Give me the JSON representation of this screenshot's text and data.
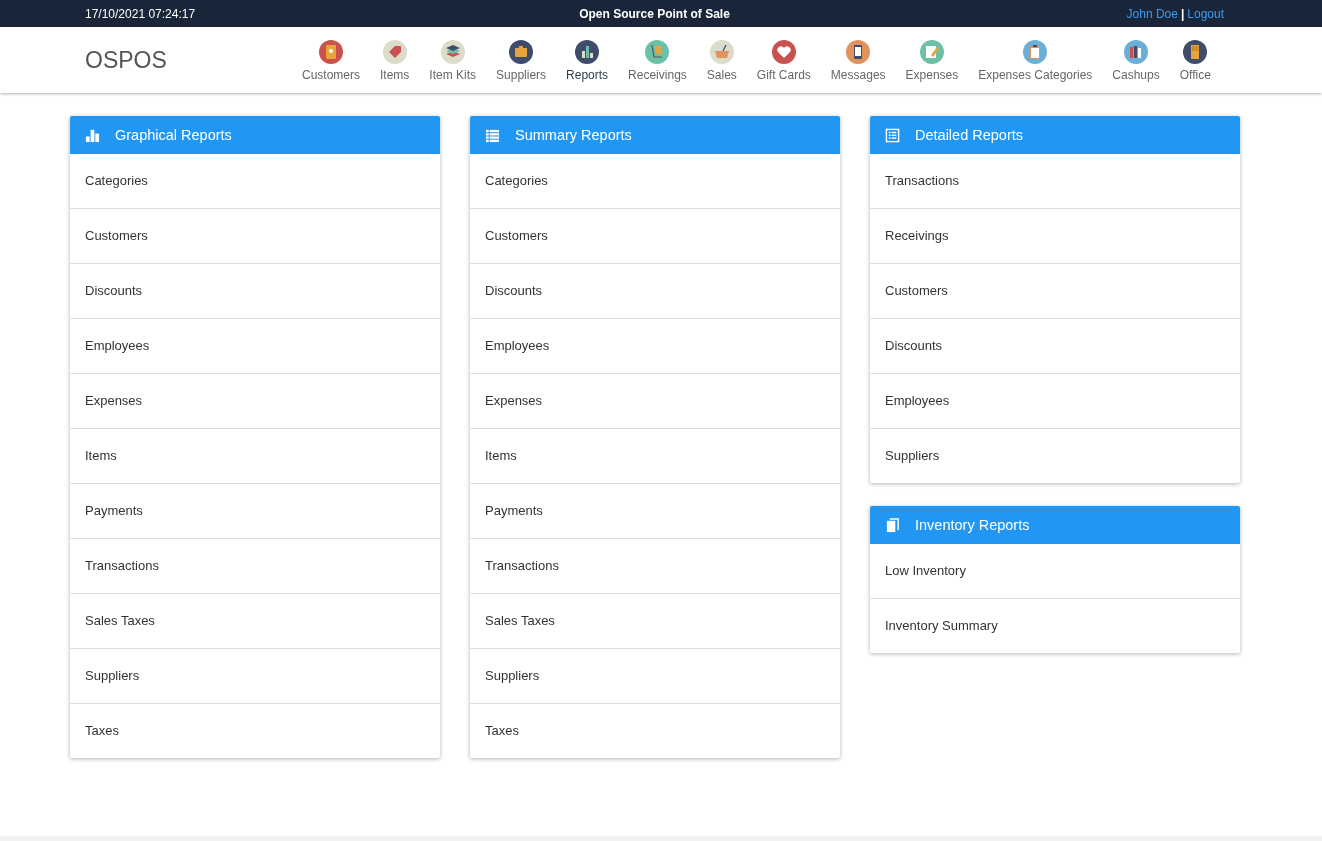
{
  "top_bar": {
    "datetime": "17/10/2021 07:24:17",
    "title": "Open Source Point of Sale",
    "user": "John Doe",
    "separator": "|",
    "logout": "Logout"
  },
  "brand": "OSPOS",
  "nav": [
    {
      "label": "Customers",
      "kind": "book",
      "color": "#c9524f",
      "selected": false
    },
    {
      "label": "Items",
      "kind": "tag",
      "color": "#dcdccb",
      "selected": false
    },
    {
      "label": "Item Kits",
      "kind": "stack",
      "color": "#dcdccb",
      "selected": false
    },
    {
      "label": "Suppliers",
      "kind": "briefcase",
      "color": "#3f4d6b",
      "selected": false
    },
    {
      "label": "Reports",
      "kind": "bars",
      "color": "#3f4d6b",
      "selected": true
    },
    {
      "label": "Receivings",
      "kind": "dolly",
      "color": "#6cc0a8",
      "selected": false
    },
    {
      "label": "Sales",
      "kind": "basket",
      "color": "#dcdccb",
      "selected": false
    },
    {
      "label": "Gift Cards",
      "kind": "heart",
      "color": "#c9524f",
      "selected": false
    },
    {
      "label": "Messages",
      "kind": "phone",
      "color": "#e0935a",
      "selected": false
    },
    {
      "label": "Expenses",
      "kind": "pencil",
      "color": "#6cc0a8",
      "selected": false
    },
    {
      "label": "Expenses Categories",
      "kind": "clipboard",
      "color": "#6aafd8",
      "selected": false
    },
    {
      "label": "Cashups",
      "kind": "books",
      "color": "#6aafd8",
      "selected": false
    },
    {
      "label": "Office",
      "kind": "door",
      "color": "#3f4d6b",
      "selected": false
    }
  ],
  "columns": [
    [
      {
        "title": "Graphical Reports",
        "kind": "bars",
        "items": [
          "Categories",
          "Customers",
          "Discounts",
          "Employees",
          "Expenses",
          "Items",
          "Payments",
          "Transactions",
          "Sales Taxes",
          "Suppliers",
          "Taxes"
        ]
      }
    ],
    [
      {
        "title": "Summary Reports",
        "kind": "list",
        "items": [
          "Categories",
          "Customers",
          "Discounts",
          "Employees",
          "Expenses",
          "Items",
          "Payments",
          "Transactions",
          "Sales Taxes",
          "Suppliers",
          "Taxes"
        ]
      }
    ],
    [
      {
        "title": "Detailed Reports",
        "kind": "sheet",
        "items": [
          "Transactions",
          "Receivings",
          "Customers",
          "Discounts",
          "Employees",
          "Suppliers"
        ]
      },
      {
        "title": "Inventory Reports",
        "kind": "book",
        "items": [
          "Low Inventory",
          "Inventory Summary"
        ]
      }
    ]
  ]
}
